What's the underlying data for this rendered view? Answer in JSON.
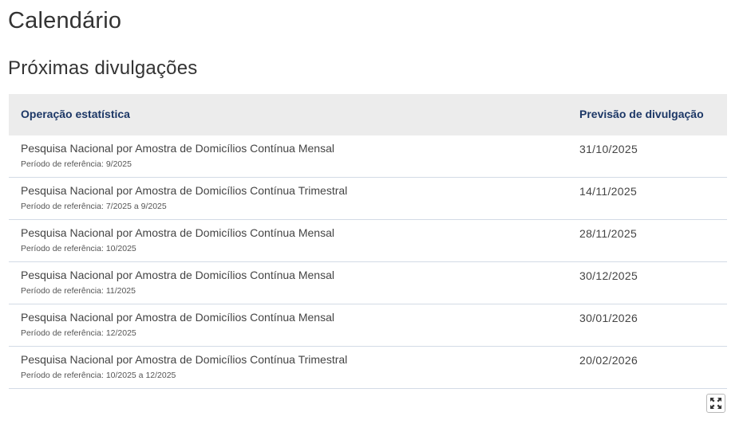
{
  "header": {
    "title": "Calendário",
    "section_title": "Próximas divulgações"
  },
  "table": {
    "columns": [
      "Operação estatística",
      "Previsão de divulgação"
    ],
    "rows": [
      {
        "name": "Pesquisa Nacional por Amostra de Domicílios Contínua Mensal",
        "ref": "Período de referência: 9/2025",
        "date": "31/10/2025"
      },
      {
        "name": "Pesquisa Nacional por Amostra de Domicílios Contínua Trimestral",
        "ref": "Período de referência: 7/2025 a 9/2025",
        "date": "14/11/2025"
      },
      {
        "name": "Pesquisa Nacional por Amostra de Domicílios Contínua Mensal",
        "ref": "Período de referência: 10/2025",
        "date": "28/11/2025"
      },
      {
        "name": "Pesquisa Nacional por Amostra de Domicílios Contínua Mensal",
        "ref": "Período de referência: 11/2025",
        "date": "30/12/2025"
      },
      {
        "name": "Pesquisa Nacional por Amostra de Domicílios Contínua Mensal",
        "ref": "Período de referência: 12/2025",
        "date": "30/01/2026"
      },
      {
        "name": "Pesquisa Nacional por Amostra de Domicílios Contínua Trimestral",
        "ref": "Período de referência: 10/2025 a 12/2025",
        "date": "20/02/2026"
      }
    ]
  },
  "controls": {
    "expand_icon": "expand-icon"
  },
  "colors": {
    "header_bg": "#ececec",
    "header_text": "#1c3766",
    "row_border": "#d3dbe6"
  }
}
